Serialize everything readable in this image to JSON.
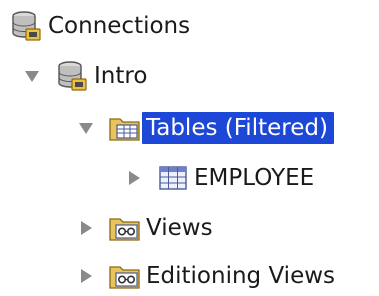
{
  "tree": {
    "root": {
      "label": "Connections",
      "icon": "connections-icon"
    },
    "connection": {
      "label": "Intro",
      "icon": "database-connection-icon",
      "expanded": true
    },
    "tables": {
      "label": "Tables (Filtered)",
      "icon": "tables-folder-icon",
      "expanded": true,
      "selected": true
    },
    "employee": {
      "label": "EMPLOYEE",
      "icon": "table-grid-icon",
      "expanded": false
    },
    "views": {
      "label": "Views",
      "icon": "views-folder-icon",
      "expanded": false
    },
    "editioning_views": {
      "label": "Editioning Views",
      "icon": "views-folder-icon",
      "expanded": false
    }
  },
  "colors": {
    "selection": "#1d47d6",
    "expander": "#8a8a8a",
    "folder": "#e8c45a"
  }
}
